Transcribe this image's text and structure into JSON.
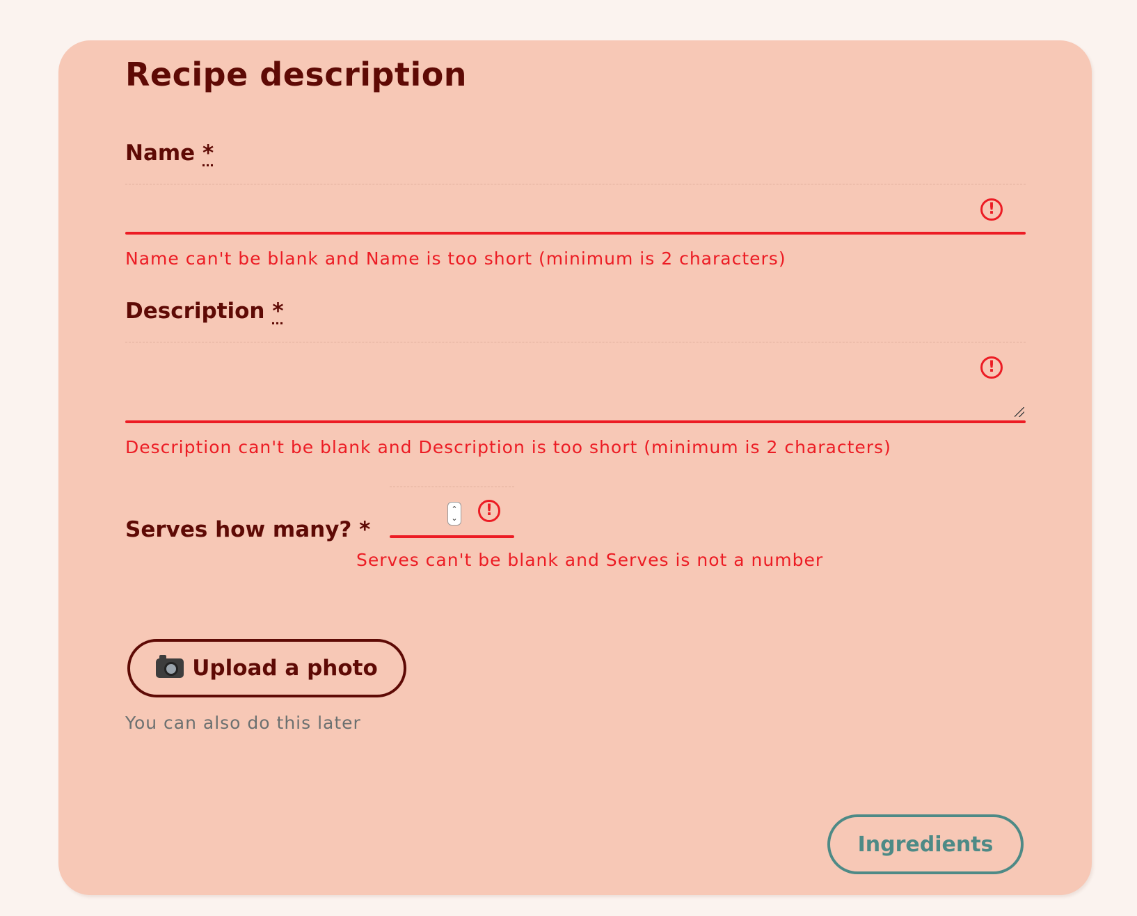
{
  "form": {
    "title": "Recipe description",
    "name": {
      "label": "Name",
      "required_mark": "*",
      "value": "",
      "error": "Name can't be blank and Name is too short (minimum is 2 characters)"
    },
    "description": {
      "label": "Description",
      "required_mark": "*",
      "value": "",
      "error": "Description can't be blank and Description is too short (minimum is 2 characters)"
    },
    "serves": {
      "label": "Serves how many? *",
      "value": "",
      "error": "Serves can't be blank and Serves is not a number"
    },
    "upload": {
      "label": "Upload a photo",
      "icon": "camera-icon",
      "hint": "You can also do this later"
    },
    "next_button": "Ingredients"
  },
  "icons": {
    "error_icon": "alert-circle-icon"
  },
  "colors": {
    "page_background": "#fbf3ef",
    "card_background": "#f7c8b6",
    "text_primary": "#5e0a05",
    "error": "#ec1c24",
    "hint": "#6b7070",
    "accent_button": "#4e8a86"
  }
}
